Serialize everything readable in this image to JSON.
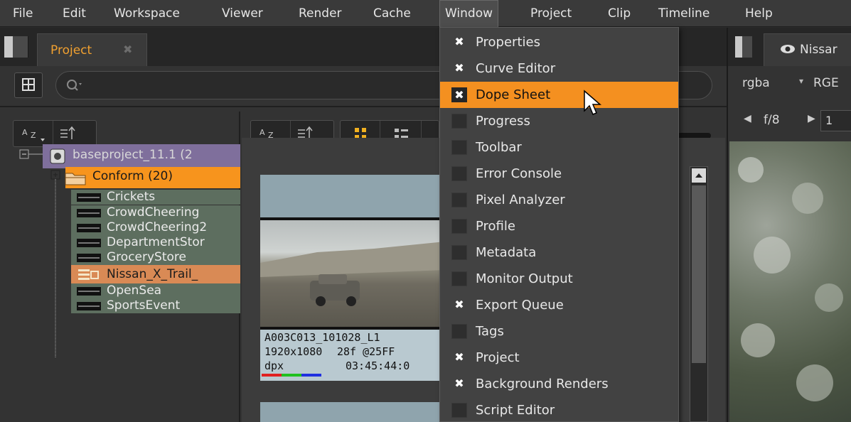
{
  "menubar": {
    "items": [
      "File",
      "Edit",
      "Workspace",
      "Viewer",
      "Render",
      "Cache",
      "Window",
      "Project",
      "Clip",
      "Timeline",
      "Help"
    ]
  },
  "project_panel": {
    "tab_label": "Project",
    "tab_close": "✖",
    "search_placeholder": "",
    "tree": {
      "root_label": "baseproject_11.1 (2",
      "conform_label": "Conform (20)",
      "clips": [
        "Crickets",
        "CrowdCheering",
        "CrowdCheering2",
        "DepartmentStor",
        "GroceryStore",
        "Nissan_X_Trail_",
        "OpenSea",
        "SportsEvent"
      ]
    },
    "thumbnail": {
      "name": "A003C013_101028_L1",
      "resolution": "1920x1080",
      "rate": "28f @25FF",
      "format": "dpx",
      "timecode": "03:45:44:0"
    }
  },
  "viewer": {
    "tab_label": "Nissar",
    "channel": "rgba",
    "channel2": "RGE",
    "fstop": "f/8",
    "frame": "1"
  },
  "window_menu": {
    "items": [
      {
        "label": "Properties",
        "checked": true
      },
      {
        "label": "Curve Editor",
        "checked": true
      },
      {
        "label": "Dope Sheet",
        "checked": true,
        "highlighted": true
      },
      {
        "label": "Progress",
        "checked": false
      },
      {
        "label": "Toolbar",
        "checked": false
      },
      {
        "label": "Error Console",
        "checked": false
      },
      {
        "label": "Pixel Analyzer",
        "checked": false
      },
      {
        "label": "Profile",
        "checked": false
      },
      {
        "label": "Metadata",
        "checked": false
      },
      {
        "label": "Monitor Output",
        "checked": false
      },
      {
        "label": "Export Queue",
        "checked": true
      },
      {
        "label": "Tags",
        "checked": false
      },
      {
        "label": "Project",
        "checked": true
      },
      {
        "label": "Background Renders",
        "checked": true
      },
      {
        "label": "Script Editor",
        "checked": false
      }
    ]
  },
  "colors": {
    "accent": "#f49020",
    "tree_root": "#7f6f9c",
    "tree_clip": "#5d6e5f"
  }
}
